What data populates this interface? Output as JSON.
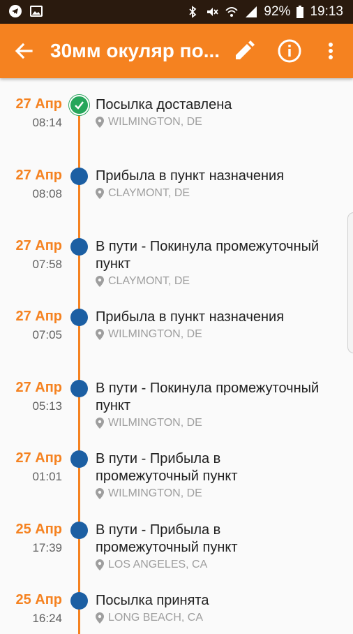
{
  "status_bar": {
    "battery": "92%",
    "time": "19:13"
  },
  "appbar": {
    "title": "30мм окуляр по...",
    "back_icon": "arrow-back-icon",
    "edit_icon": "pencil-icon",
    "info_icon": "info-icon",
    "more_icon": "more-vert-icon"
  },
  "colors": {
    "accent": "#f58220",
    "dot": "#1c5fa3",
    "delivered": "#26a65b"
  },
  "events": [
    {
      "date": "27 Апр",
      "time": "08:14",
      "status": "Посылка доставлена",
      "location": "WILMINGTON, DE",
      "delivered": true
    },
    {
      "date": "27 Апр",
      "time": "08:08",
      "status": "Прибыла в пункт назначения",
      "location": "CLAYMONT, DE"
    },
    {
      "date": "27 Апр",
      "time": "07:58",
      "status": "В пути - Покинула промежуточный пункт",
      "location": "CLAYMONT, DE"
    },
    {
      "date": "27 Апр",
      "time": "07:05",
      "status": "Прибыла в пункт назначения",
      "location": "WILMINGTON, DE"
    },
    {
      "date": "27 Апр",
      "time": "05:13",
      "status": "В пути - Покинула промежуточный пункт",
      "location": "WILMINGTON, DE"
    },
    {
      "date": "27 Апр",
      "time": "01:01",
      "status": "В пути - Прибыла в промежуточный пункт",
      "location": "WILMINGTON, DE"
    },
    {
      "date": "25 Апр",
      "time": "17:39",
      "status": "В пути - Прибыла в промежуточный пункт",
      "location": "LOS ANGELES, CA"
    },
    {
      "date": "25 Апр",
      "time": "16:24",
      "status": "Посылка принята",
      "location": "LONG BEACH, CA"
    }
  ]
}
